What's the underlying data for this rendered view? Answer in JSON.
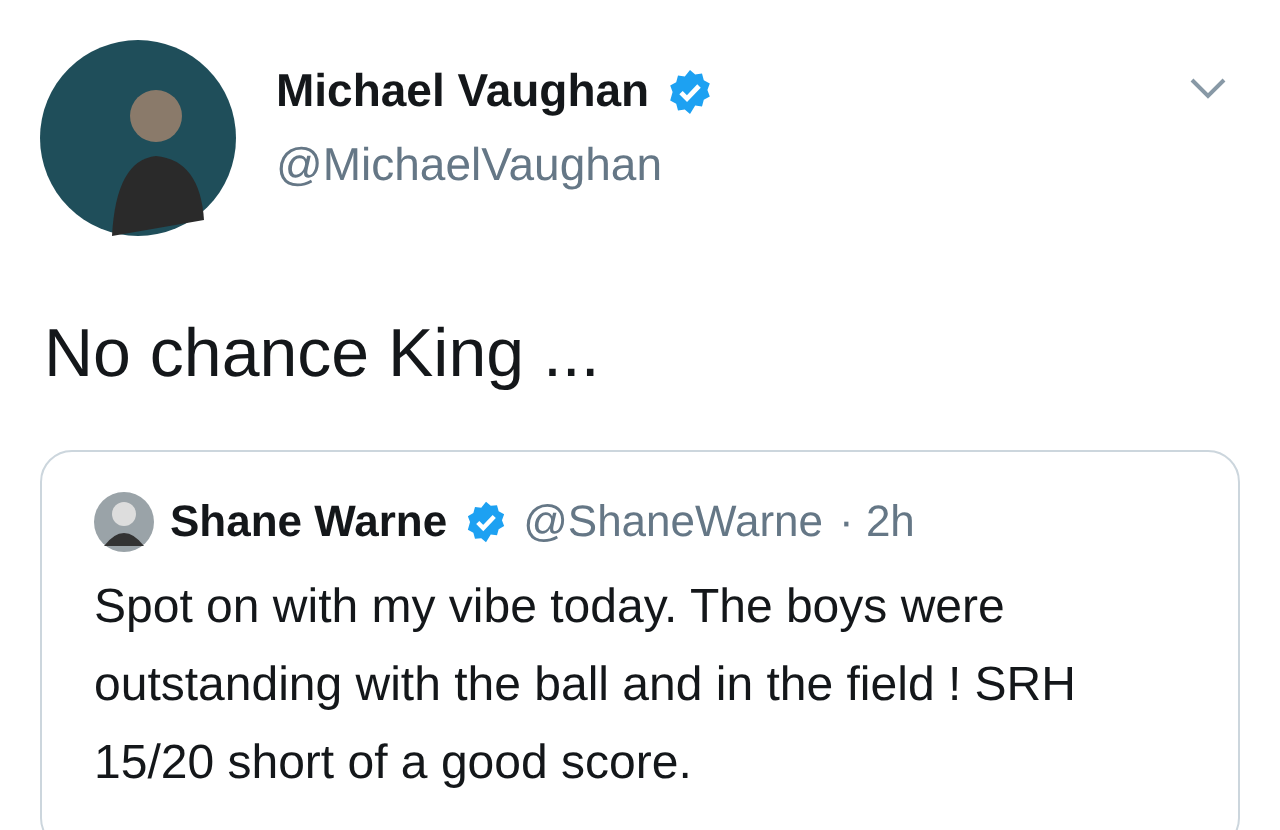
{
  "author": {
    "name": "Michael Vaughan",
    "verified": true,
    "handle": "@MichaelVaughan"
  },
  "tweet_text": "No chance King ...",
  "quoted_tweet": {
    "name": "Shane Warne",
    "verified": true,
    "handle": "@ShaneWarne",
    "time": "· 2h",
    "text": "Spot on with my vibe today. The boys were outstanding with the ball and in the field ! SRH 15/20 short of a good score."
  }
}
